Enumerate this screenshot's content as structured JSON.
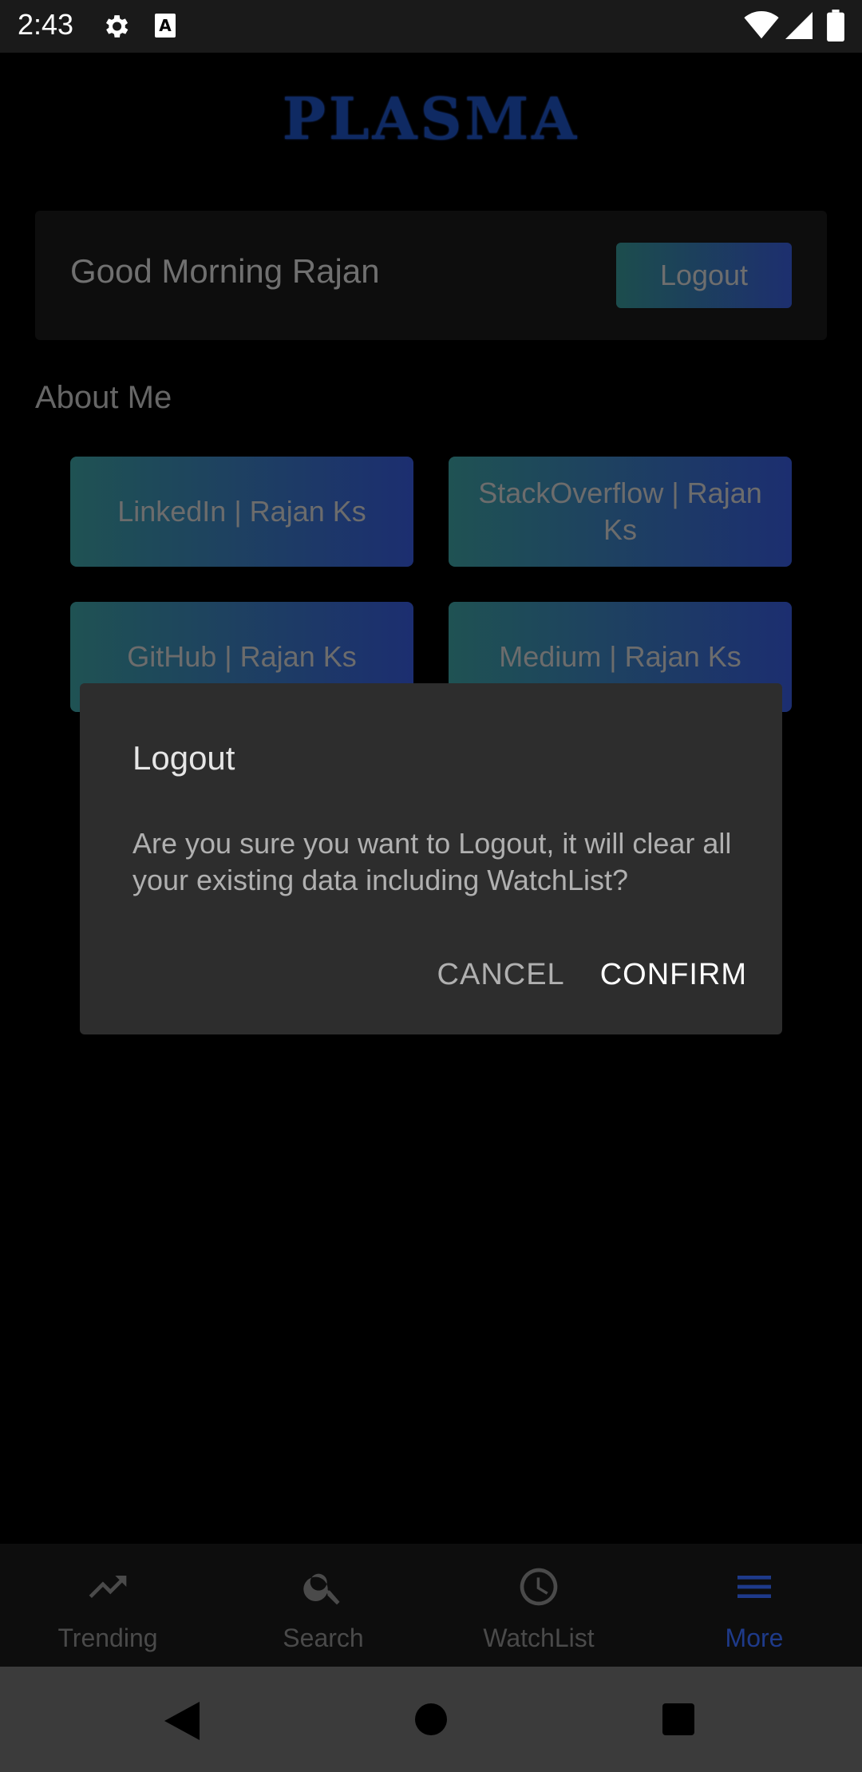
{
  "status_bar": {
    "time": "2:43",
    "a_icon_letter": "A"
  },
  "app": {
    "logo": "PLASMA",
    "greeting": "Good Morning Rajan",
    "logout_label": "Logout",
    "about_title": "About Me",
    "links": [
      {
        "label": "LinkedIn | Rajan Ks"
      },
      {
        "label": "StackOverflow | Rajan Ks"
      },
      {
        "label": "GitHub | Rajan Ks"
      },
      {
        "label": "Medium | Rajan Ks"
      }
    ]
  },
  "dialog": {
    "title": "Logout",
    "message": "Are you sure you want to Logout, it will clear all your existing data including WatchList?",
    "cancel_label": "CANCEL",
    "confirm_label": "CONFIRM"
  },
  "bottom_nav": {
    "items": [
      {
        "label": "Trending",
        "icon": "trending-icon"
      },
      {
        "label": "Search",
        "icon": "search-icon"
      },
      {
        "label": "WatchList",
        "icon": "clock-icon"
      },
      {
        "label": "More",
        "icon": "menu-icon"
      }
    ],
    "active_index": 3
  },
  "colors": {
    "accent": "#1e3a8a",
    "button_gradient_start": "#1f5253",
    "button_gradient_end": "#1c2e70",
    "dialog_bg": "#2d2d2d"
  }
}
